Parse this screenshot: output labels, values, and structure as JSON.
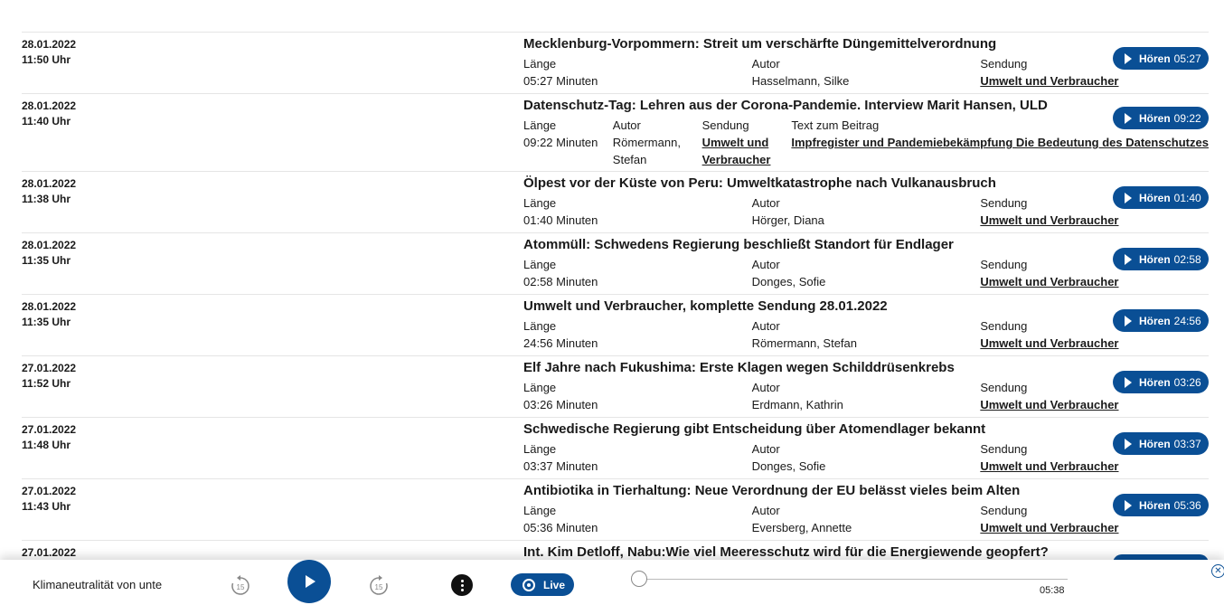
{
  "episodes": [
    {
      "date": "28.01.2022",
      "time": "11:50 Uhr",
      "title": "Mecklenburg-Vorpommern: Streit um verschärfte Düngemittelverordnung",
      "length_label": "Länge",
      "length": "05:27 Minuten",
      "author_label": "Autor",
      "author": "Hasselmann, Silke",
      "show_label": "Sendung",
      "show": "Umwelt und Verbraucher",
      "button_label": "Hören",
      "button_time": "05:27"
    },
    {
      "date": "28.01.2022",
      "time": "11:40 Uhr",
      "title": "Datenschutz-Tag: Lehren aus der Corona-Pandemie. Interview Marit Hansen, ULD",
      "length_label": "Länge",
      "length": "09:22 Minuten",
      "author_label": "Autor",
      "author_line1": "Römermann,",
      "author_line2": "Stefan",
      "show_label": "Sendung",
      "show_line1": "Umwelt und",
      "show_line2": "Verbraucher",
      "text_label": "Text zum Beitrag",
      "text_link": "Impfregister und Pandemiebekämpfung Die Bedeutung des Datenschutzes",
      "button_label": "Hören",
      "button_time": "09:22"
    },
    {
      "date": "28.01.2022",
      "time": "11:38 Uhr",
      "title": "Ölpest vor der Küste von Peru: Umweltkatastrophe nach Vulkanausbruch",
      "length_label": "Länge",
      "length": "01:40 Minuten",
      "author_label": "Autor",
      "author": "Hörger, Diana",
      "show_label": "Sendung",
      "show": "Umwelt und Verbraucher",
      "button_label": "Hören",
      "button_time": "01:40"
    },
    {
      "date": "28.01.2022",
      "time": "11:35 Uhr",
      "title": "Atommüll: Schwedens Regierung beschließt Standort für Endlager",
      "length_label": "Länge",
      "length": "02:58 Minuten",
      "author_label": "Autor",
      "author": "Donges, Sofie",
      "show_label": "Sendung",
      "show": "Umwelt und Verbraucher",
      "button_label": "Hören",
      "button_time": "02:58"
    },
    {
      "date": "28.01.2022",
      "time": "11:35 Uhr",
      "title": "Umwelt und Verbraucher, komplette Sendung 28.01.2022",
      "length_label": "Länge",
      "length": "24:56 Minuten",
      "author_label": "Autor",
      "author": "Römermann, Stefan",
      "show_label": "Sendung",
      "show": "Umwelt und Verbraucher",
      "button_label": "Hören",
      "button_time": "24:56"
    },
    {
      "date": "27.01.2022",
      "time": "11:52 Uhr",
      "title": "Elf Jahre nach Fukushima: Erste Klagen wegen Schilddrüsenkrebs",
      "length_label": "Länge",
      "length": "03:26 Minuten",
      "author_label": "Autor",
      "author": "Erdmann, Kathrin",
      "show_label": "Sendung",
      "show": "Umwelt und Verbraucher",
      "button_label": "Hören",
      "button_time": "03:26"
    },
    {
      "date": "27.01.2022",
      "time": "11:48 Uhr",
      "title": "Schwedische Regierung gibt Entscheidung über Atomendlager bekannt",
      "length_label": "Länge",
      "length": "03:37 Minuten",
      "author_label": "Autor",
      "author": "Donges, Sofie",
      "show_label": "Sendung",
      "show": "Umwelt und Verbraucher",
      "button_label": "Hören",
      "button_time": "03:37"
    },
    {
      "date": "27.01.2022",
      "time": "11:43 Uhr",
      "title": "Antibiotika in Tierhaltung: Neue Verordnung der EU belässt vieles beim Alten",
      "length_label": "Länge",
      "length": "05:36 Minuten",
      "author_label": "Autor",
      "author": "Eversberg, Annette",
      "show_label": "Sendung",
      "show": "Umwelt und Verbraucher",
      "button_label": "Hören",
      "button_time": "05:36"
    },
    {
      "date": "27.01.2022",
      "title": "Int. Kim Detloff, Nabu:Wie viel Meeresschutz wird für die Energiewende geopfert?"
    }
  ],
  "player": {
    "title": "Klimaneutralität von unte",
    "rewind_seconds": "15",
    "forward_seconds": "15",
    "live_label": "Live",
    "duration": "05:38",
    "progress": 0.0
  },
  "colors": {
    "accent": "#0a4f95",
    "text": "#1a1a1a",
    "divider": "#e5e5e5"
  }
}
